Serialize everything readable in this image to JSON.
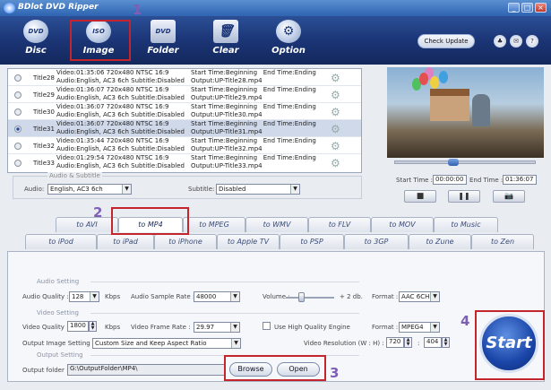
{
  "window": {
    "title": "BDlot DVD Ripper",
    "min": "_",
    "max": "□",
    "close": "×"
  },
  "toolbar": {
    "items": [
      {
        "label": "Disc",
        "icon": "DVD"
      },
      {
        "label": "Image",
        "icon": "ISO"
      },
      {
        "label": "Folder",
        "icon": "DVD"
      },
      {
        "label": "Clear",
        "icon": "🗑"
      },
      {
        "label": "Option",
        "icon": "⚙"
      }
    ],
    "check_update": "Check Update",
    "small_icons": [
      "♣",
      "✉",
      "?"
    ]
  },
  "annotations": {
    "n1": "1",
    "n2": "2",
    "n3": "3",
    "n4": "4"
  },
  "titles": [
    {
      "name": "Title28",
      "video": "Video:01:35:06 720x480 NTSC 16:9",
      "audio": "Audio:English, AC3 6ch Subtitle:Disabled",
      "start": "Start Time:Beginning",
      "end": "End Time:Ending",
      "output": "Output:UP-Title28.mp4"
    },
    {
      "name": "Title29",
      "video": "Video:01:36:07 720x480 NTSC 16:9",
      "audio": "Audio:English, AC3 6ch Subtitle:Disabled",
      "start": "Start Time:Beginning",
      "end": "End Time:Ending",
      "output": "Output:UP-Title29.mp4"
    },
    {
      "name": "Title30",
      "video": "Video:01:36:07 720x480 NTSC 16:9",
      "audio": "Audio:English, AC3 6ch Subtitle:Disabled",
      "start": "Start Time:Beginning",
      "end": "End Time:Ending",
      "output": "Output:UP-Title30.mp4"
    },
    {
      "name": "Title31",
      "video": "Video:01:36:07 720x480 NTSC 16:9",
      "audio": "Audio:English, AC3 6ch Subtitle:Disabled",
      "start": "Start Time:Beginning",
      "end": "End Time:Ending",
      "output": "Output:UP-Title31.mp4"
    },
    {
      "name": "Title32",
      "video": "Video:01:35:44 720x480 NTSC 16:9",
      "audio": "Audio:English, AC3 6ch Subtitle:Disabled",
      "start": "Start Time:Beginning",
      "end": "End Time:Ending",
      "output": "Output:UP-Title32.mp4"
    },
    {
      "name": "Title33",
      "video": "Video:01:29:54 720x480 NTSC 16:9",
      "audio": "Audio:English, AC3 6ch Subtitle:Disabled",
      "start": "Start Time:Beginning",
      "end": "End Time:Ending",
      "output": "Output:UP-Title33.mp4"
    }
  ],
  "audio_subtitle": {
    "caption": "Audio & Subtitle",
    "audio_label": "Audio:",
    "audio_value": "English, AC3 6ch",
    "subtitle_label": "Subtitle:",
    "subtitle_value": "Disabled"
  },
  "player": {
    "start_label": "Start Time :",
    "start_value": "00:00:00",
    "end_label": "End Time :",
    "end_value": "01:36:07",
    "stop": "■",
    "pause": "❚❚",
    "snapshot": "📷",
    "progress": 0.42
  },
  "tabs_row1": [
    "to AVI",
    "to MP4",
    "to MPEG",
    "to WMV",
    "to FLV",
    "to MOV",
    "to Music"
  ],
  "tabs_row2": [
    "to iPod",
    "to iPad",
    "to iPhone",
    "to Apple TV",
    "to PSP",
    "to 3GP",
    "to Zune",
    "to Zen"
  ],
  "active_tab": "to MP4",
  "audio_setting": {
    "section": "Audio Setting",
    "quality_label": "Audio Quality :",
    "quality_value": "128",
    "kbps": "Kbps",
    "rate_label": "Audio Sample Rate :",
    "rate_value": "48000",
    "volume_label": "Volume :",
    "volume_text": "+ 2 db.",
    "format_label": "Format :",
    "format_value": "AAC 6CH"
  },
  "video_setting": {
    "section": "Video Setting",
    "quality_label": "Video Quality :",
    "quality_value": "1800",
    "kbps": "Kbps",
    "framerate_label": "Video Frame Rate :",
    "framerate_value": "29.97",
    "hq_label": "Use High Quality Engine",
    "format_label": "Format :",
    "format_value": "MPEG4",
    "output_image_label": "Output Image Setting :",
    "output_image_value": "Custom Size and Keep Aspect Ratio",
    "resolution_label": "Video Resolution (W : H) :",
    "width": "720",
    "colon": ":",
    "height": "404"
  },
  "output_setting": {
    "section": "Output Setting",
    "folder_label": "Output folder :",
    "folder_value": "G:\\OutputFolder\\MP4\\",
    "browse": "Browse",
    "open": "Open"
  },
  "start_button": "Start"
}
